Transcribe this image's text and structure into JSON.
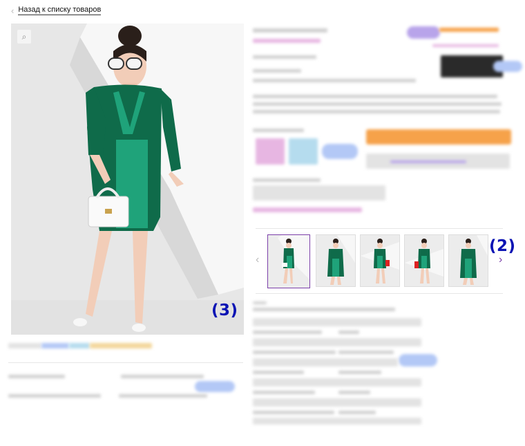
{
  "nav": {
    "back_label": "Назад к списку товаров",
    "back_icon": "chevron-left-icon"
  },
  "gallery": {
    "zoom_icon": "magnifier-icon",
    "marker_main": "(3)",
    "marker_thumbs": "(2)",
    "prev_icon": "chevron-left-icon",
    "next_icon": "chevron-right-icon",
    "thumb_count": 5,
    "active_thumb": 1
  },
  "colors": {
    "accent": "#7b3fa9",
    "marker": "#0b14b4",
    "dress_dark": "#0f6b4a",
    "dress_light": "#1fa37a",
    "cta": "#f6a24a"
  }
}
